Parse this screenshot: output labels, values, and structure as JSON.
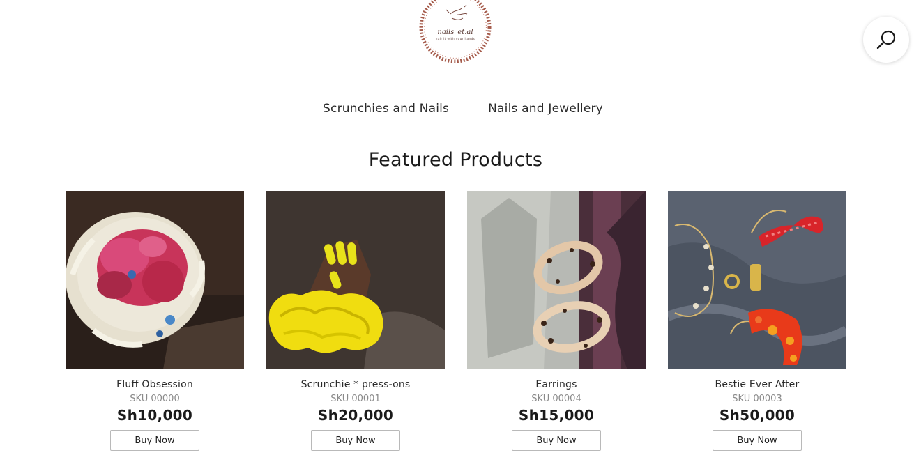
{
  "brand": {
    "logo_name": "nails_et.al",
    "logo_tagline": "hair it with your hands",
    "ring_color": "#a55b4b"
  },
  "search": {
    "icon": "search-icon"
  },
  "nav": {
    "items": [
      {
        "label": "Scrunchies and Nails"
      },
      {
        "label": "Nails and Jewellery"
      }
    ]
  },
  "featured": {
    "title": "Featured Products",
    "buy_label": "Buy Now",
    "products": [
      {
        "name": "Fluff Obsession",
        "sku": "SKU 00000",
        "price": "Sh10,000",
        "image": "fluffy-scrunchie-photo"
      },
      {
        "name": "Scrunchie * press-ons",
        "sku": "SKU 00001",
        "price": "Sh20,000",
        "image": "yellow-scrunchie-nails-photo"
      },
      {
        "name": "Earrings",
        "sku": "SKU 00004",
        "price": "Sh15,000",
        "image": "tortoiseshell-earrings-photo"
      },
      {
        "name": "Bestie Ever After",
        "sku": "SKU 00003",
        "price": "Sh50,000",
        "image": "red-jewellery-set-photo"
      }
    ]
  }
}
